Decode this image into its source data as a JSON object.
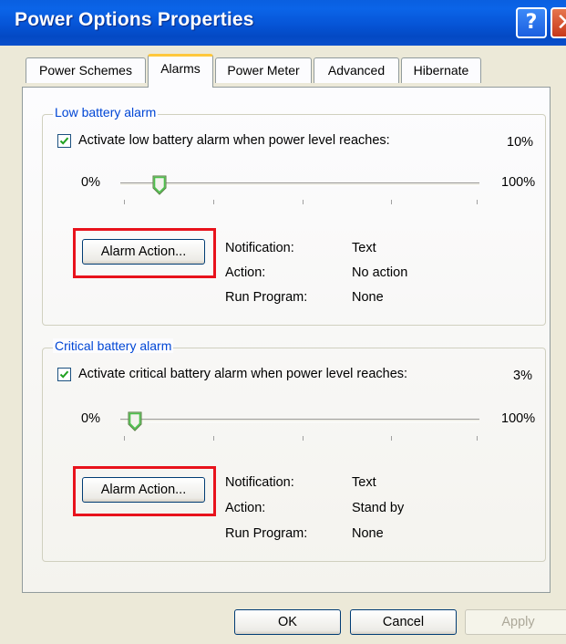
{
  "window": {
    "title": "Power Options Properties"
  },
  "title_buttons": {
    "help_glyph": "?",
    "close_glyph": "✕"
  },
  "tabs": [
    {
      "label": "Power Schemes"
    },
    {
      "label": "Alarms"
    },
    {
      "label": "Power Meter"
    },
    {
      "label": "Advanced"
    },
    {
      "label": "Hibernate"
    }
  ],
  "selected_tab": "Alarms",
  "low_battery": {
    "group_label": "Low battery alarm",
    "activate_label": "Activate low battery alarm when power level reaches:",
    "activate_checked": true,
    "level": "10%",
    "slider_min": "0%",
    "slider_max": "100%",
    "slider_value_percent": 10,
    "button_label": "Alarm Action...",
    "notification_label": "Notification:",
    "notification_value": "Text",
    "action_label": "Action:",
    "action_value": "No action",
    "run_program_label": "Run Program:",
    "run_program_value": "None"
  },
  "critical_battery": {
    "group_label": "Critical battery alarm",
    "activate_label": "Activate critical battery alarm when power level reaches:",
    "activate_checked": true,
    "level": "3%",
    "slider_min": "0%",
    "slider_max": "100%",
    "slider_value_percent": 3,
    "button_label": "Alarm Action...",
    "notification_label": "Notification:",
    "notification_value": "Text",
    "action_label": "Action:",
    "action_value": "Stand by",
    "run_program_label": "Run Program:",
    "run_program_value": "None"
  },
  "footer": {
    "ok_label": "OK",
    "cancel_label": "Cancel",
    "apply_label": "Apply"
  },
  "colors": {
    "title_bar": "#0A5FE0",
    "highlight_box": "#E8121C",
    "group_label": "#0046D5",
    "selected_tab_accent": "#FFC83C"
  }
}
